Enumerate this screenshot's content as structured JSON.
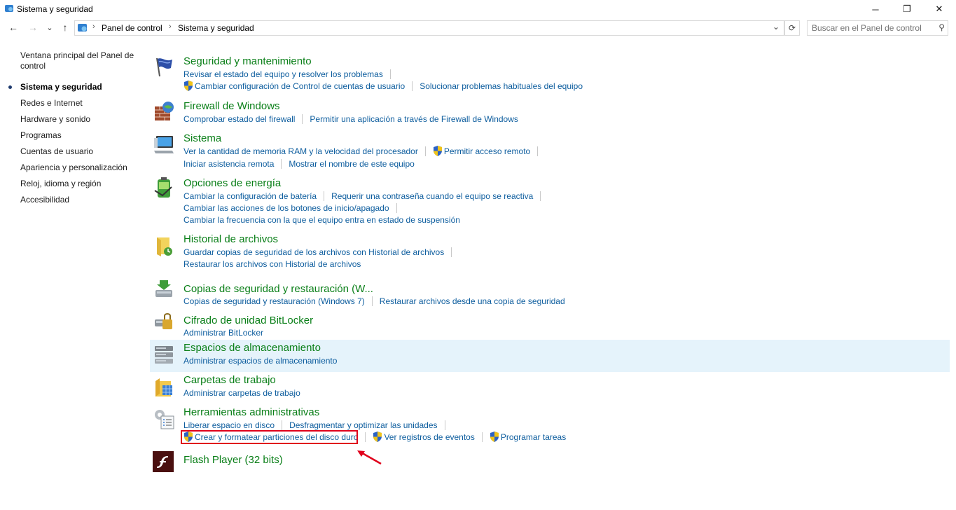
{
  "window": {
    "title": "Sistema y seguridad",
    "controls": {
      "minimize": "─",
      "restore": "❐",
      "close": "✕"
    }
  },
  "address": {
    "back": "←",
    "forward": "→",
    "recent": "⌄",
    "up": "↑",
    "crumbs": [
      "Panel de control",
      "Sistema y seguridad"
    ],
    "crumb_separator": "›",
    "dropdown": "⌄",
    "refresh": "⟳",
    "search_placeholder": "Buscar en el Panel de control",
    "search_icon": "⚲"
  },
  "sidebar": {
    "items": [
      {
        "label": "Ventana principal del Panel de control"
      },
      {
        "label": "Sistema y seguridad",
        "active": true
      },
      {
        "label": "Redes e Internet"
      },
      {
        "label": "Hardware y sonido"
      },
      {
        "label": "Programas"
      },
      {
        "label": "Cuentas de usuario"
      },
      {
        "label": "Apariencia y personalización"
      },
      {
        "label": "Reloj, idioma y región"
      },
      {
        "label": "Accesibilidad"
      }
    ]
  },
  "categories": [
    {
      "title": "Seguridad y mantenimiento",
      "icon": "flag-icon",
      "rows": [
        [
          "Revisar el estado del equipo y resolver los problemas"
        ],
        [
          "Cambiar configuración de Control de cuentas de usuario",
          "Solucionar problemas habituales del equipo"
        ]
      ]
    },
    {
      "title": "Firewall de Windows",
      "icon": "firewall-icon",
      "rows": [
        [
          "Comprobar estado del firewall",
          "Permitir una aplicación a través de Firewall de Windows"
        ]
      ]
    },
    {
      "title": "Sistema",
      "icon": "computer-icon",
      "rows": [
        [
          "Ver la cantidad de memoria RAM y la velocidad del procesador",
          "Permitir acceso remoto"
        ],
        [
          "Iniciar asistencia remota",
          "Mostrar el nombre de este equipo"
        ]
      ]
    },
    {
      "title": "Opciones de energía",
      "icon": "battery-icon",
      "rows": [
        [
          "Cambiar la configuración de batería",
          "Requerir una contraseña cuando el equipo se reactiva"
        ],
        [
          "Cambiar las acciones de los botones de inicio/apagado"
        ],
        [
          "Cambiar la frecuencia con la que el equipo entra en estado de suspensión"
        ]
      ]
    },
    {
      "title": "Historial de archivos",
      "icon": "file-history-icon",
      "rows": [
        [
          "Guardar copias de seguridad de los archivos con Historial de archivos"
        ],
        [
          "Restaurar los archivos con Historial de archivos"
        ]
      ]
    },
    {
      "title": "Copias de seguridad y restauración (W...",
      "icon": "backup-icon",
      "rows": [
        [
          "Copias de seguridad y restauración (Windows 7)",
          "Restaurar archivos desde una copia de seguridad"
        ]
      ]
    },
    {
      "title": "Cifrado de unidad BitLocker",
      "icon": "bitlocker-icon",
      "rows": [
        [
          "Administrar BitLocker"
        ]
      ]
    },
    {
      "title": "Espacios de almacenamiento",
      "icon": "storage-icon",
      "rows": [
        [
          "Administrar espacios de almacenamiento"
        ]
      ]
    },
    {
      "title": "Carpetas de trabajo",
      "icon": "work-folders-icon",
      "rows": [
        [
          "Administrar carpetas de trabajo"
        ]
      ]
    },
    {
      "title": "Herramientas administrativas",
      "icon": "admin-tools-icon",
      "rows": [
        [
          "Liberar espacio en disco",
          "Desfragmentar y optimizar las unidades"
        ],
        [
          "Crear y formatear particiones del disco duro",
          "Ver registros de eventos",
          "Programar tareas"
        ]
      ]
    },
    {
      "title": "Flash Player (32 bits)",
      "icon": "flash-icon",
      "rows": []
    }
  ],
  "colors": {
    "category_title": "#0a7f18",
    "link": "#0d5d9e",
    "highlight_row": "#e5f3fb",
    "annotation": "#e0001b"
  }
}
